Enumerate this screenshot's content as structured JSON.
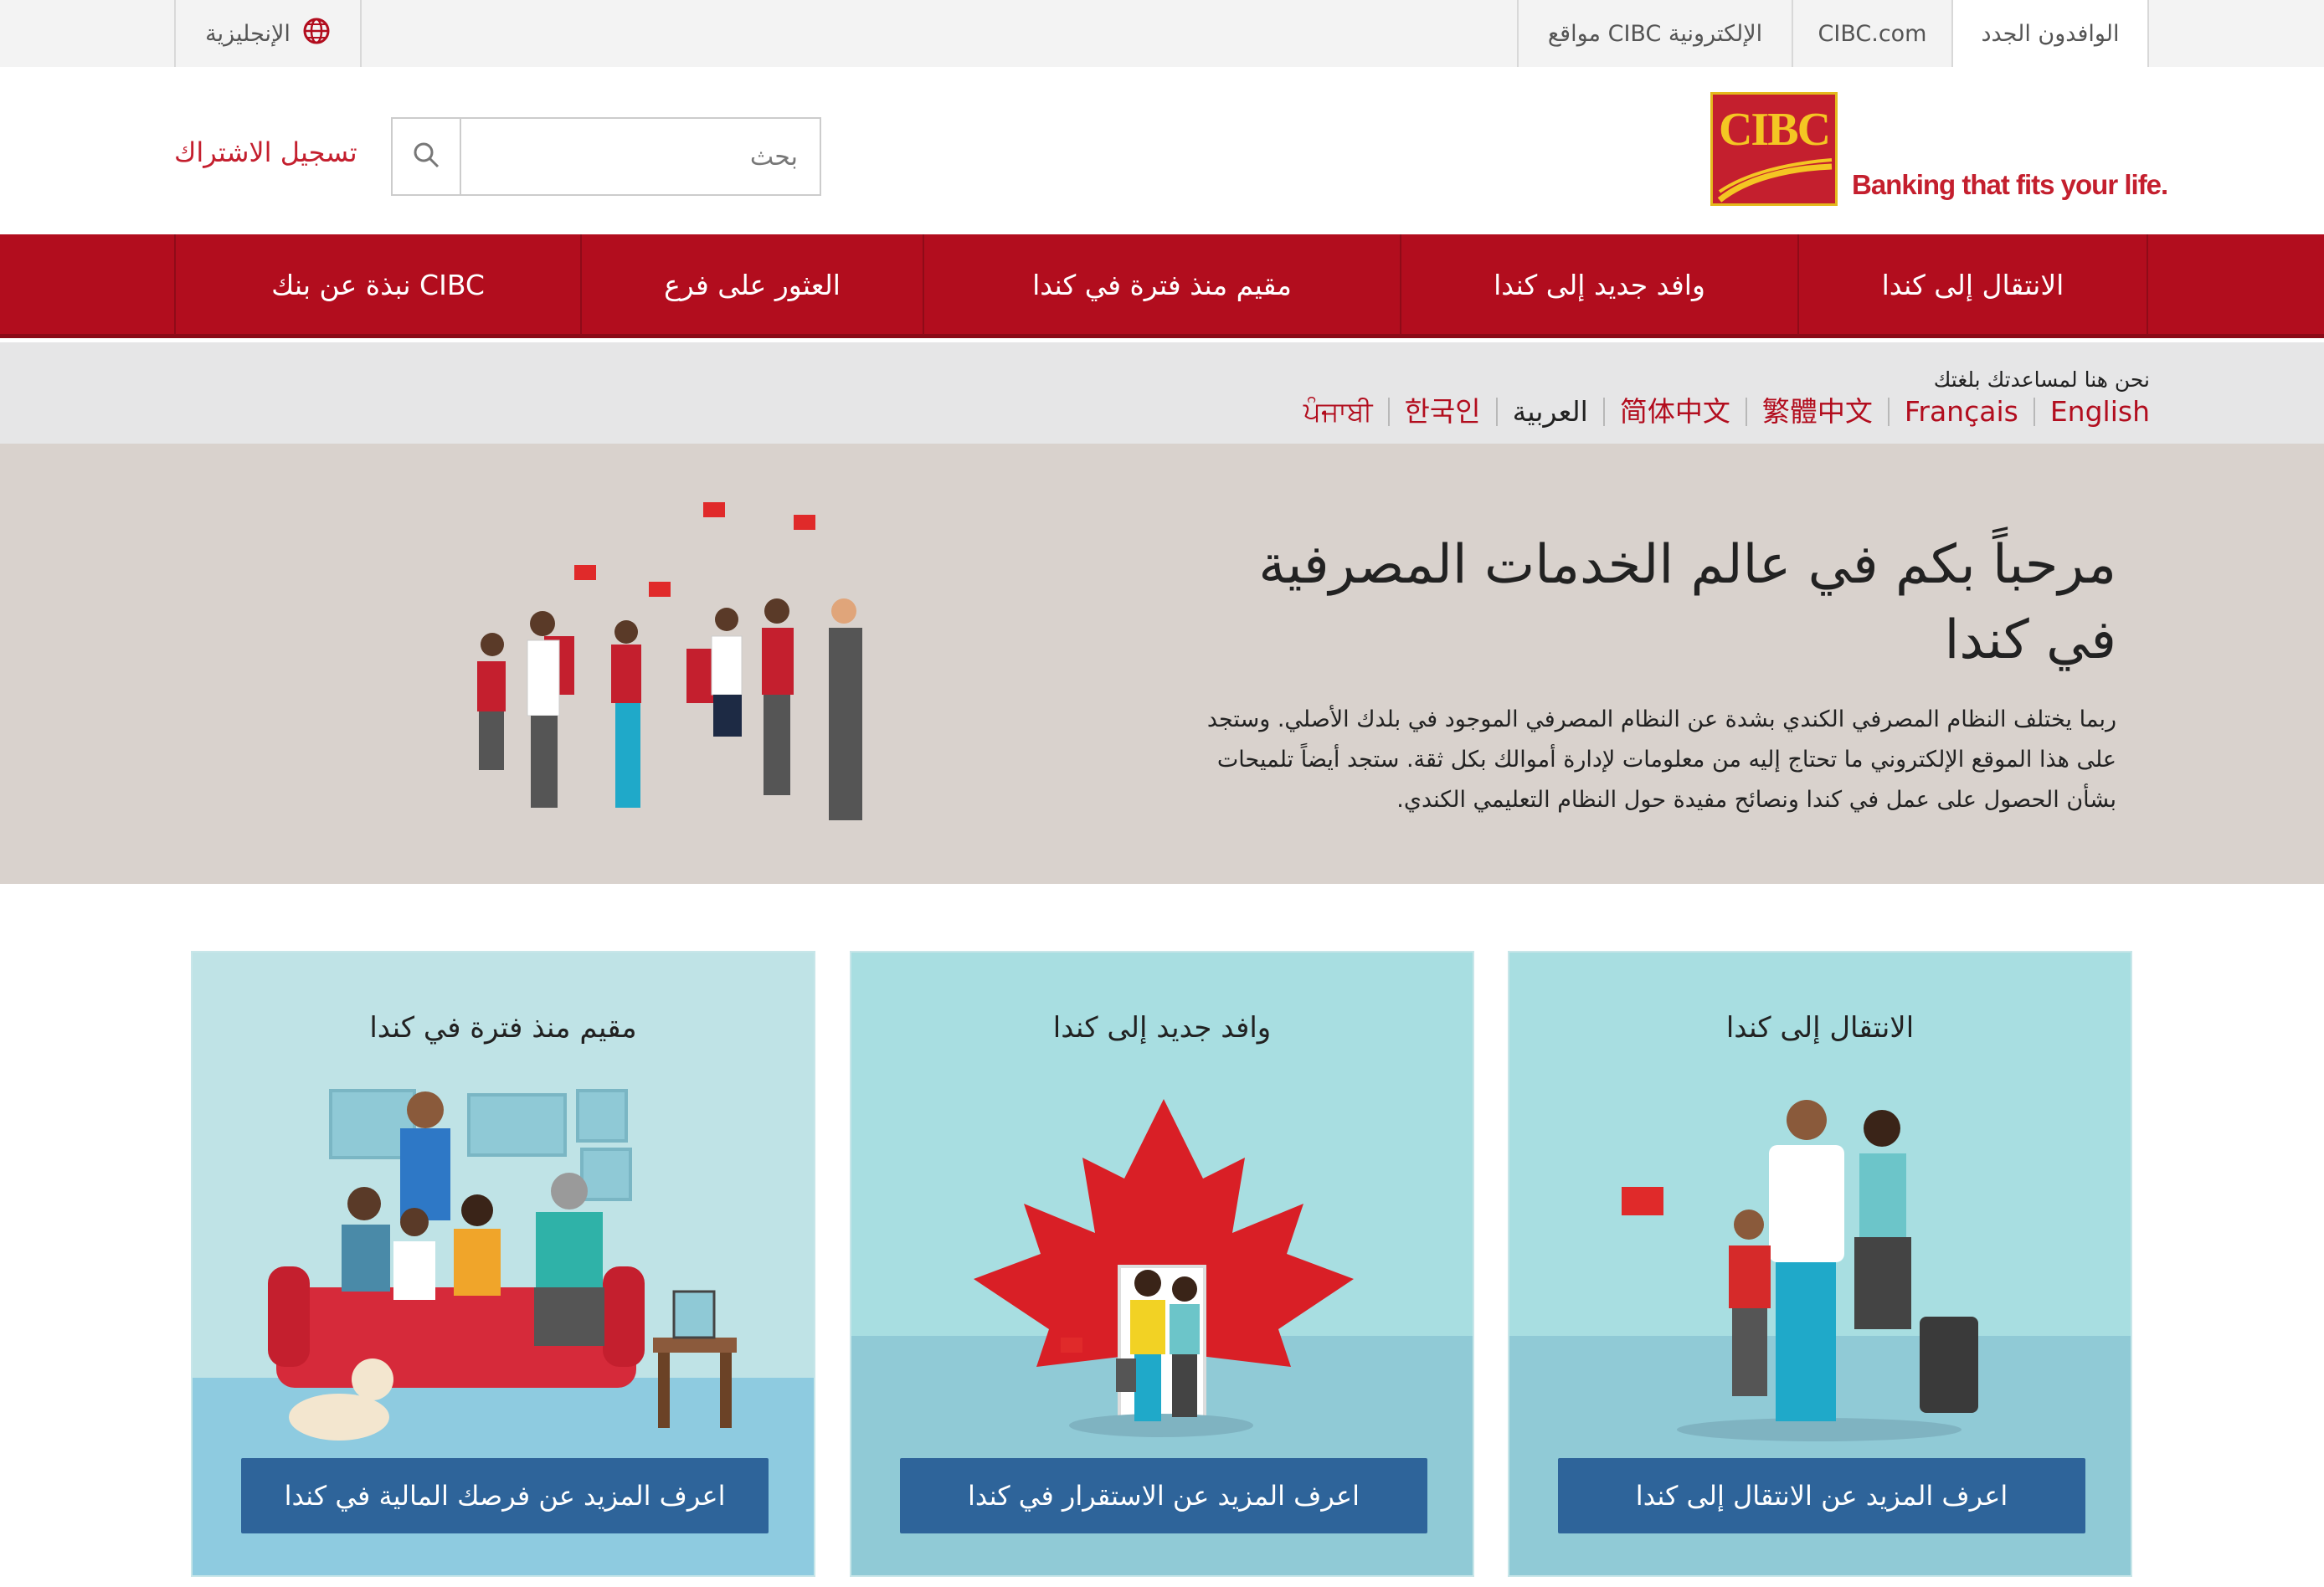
{
  "utility": {
    "tabs": [
      {
        "label": "الوافدون الجدد",
        "active": true
      },
      {
        "label": "CIBC.com",
        "active": false
      },
      {
        "label": "مواقع CIBC الإلكترونية",
        "active": false
      }
    ],
    "language_toggle": "الإنجليزية",
    "language_icon": "globe-icon"
  },
  "header": {
    "logo_text": "CIBC",
    "tagline": "Banking that fits your life.",
    "search_placeholder": "بحث",
    "search_icon": "search-icon",
    "signup_label": "تسجيل الاشتراك"
  },
  "nav": {
    "items": [
      "الانتقال إلى كندا",
      "وافد جديد إلى كندا",
      "مقيم منذ فترة في كندا",
      "العثور على فرع",
      "نبذة عن بنك CIBC"
    ]
  },
  "languages": {
    "title": "نحن هنا لمساعدتك بلغتك",
    "items": [
      "English",
      "Français",
      "繁體中文",
      "简体中文",
      "العربية",
      "한국인",
      "ਪੰਜਾਬੀ"
    ],
    "current": "العربية"
  },
  "hero": {
    "heading": "مرحباً بكم في عالم الخدمات المصرفية في كندا",
    "body": "ربما يختلف النظام المصرفي الكندي بشدة عن النظام المصرفي الموجود في بلدك الأصلي. وستجد على هذا الموقع الإلكتروني ما تحتاج إليه من معلومات لإدارة أموالك بكل ثقة. ستجد أيضاً تلميحات بشأن الحصول على عمل في كندا ونصائح مفيدة حول النظام التعليمي الكندي."
  },
  "cards": [
    {
      "title": "الانتقال إلى كندا",
      "cta": "اعرف المزيد عن الانتقال إلى كندا"
    },
    {
      "title": "وافد جديد إلى كندا",
      "cta": "اعرف المزيد عن الاستقرار في كندا"
    },
    {
      "title": "مقيم منذ فترة في كندا",
      "cta": "اعرف المزيد عن فرصك المالية في كندا"
    }
  ],
  "colors": {
    "brand_red": "#b20d1e",
    "logo_gold": "#e4b91d",
    "cta_blue": "#2e649a",
    "card_teal": "#a8dee1",
    "hero_bg": "#d9d2cd"
  }
}
